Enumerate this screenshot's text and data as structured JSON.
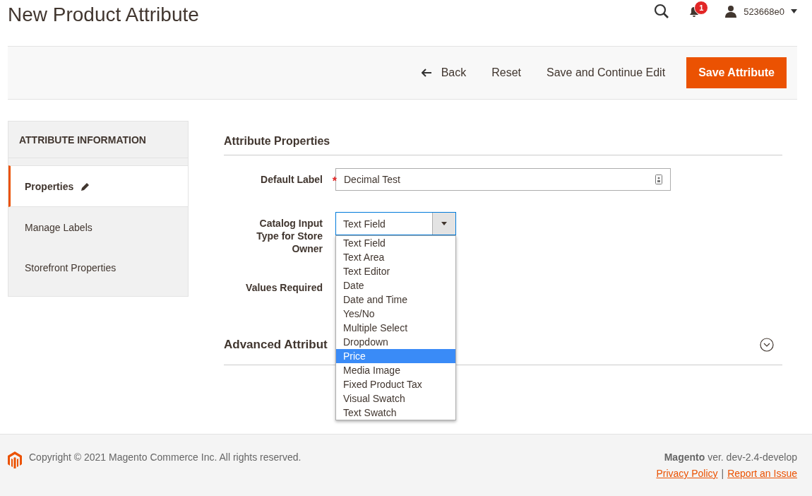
{
  "page_title": "New Product Attribute",
  "header": {
    "notification_count": "1",
    "user": "523668e0"
  },
  "actions": [
    {
      "label": "Back",
      "kind": "back"
    },
    {
      "label": "Reset",
      "kind": "plain"
    },
    {
      "label": "Save and Continue Edit",
      "kind": "plain"
    },
    {
      "label": "Save Attribute",
      "kind": "primary"
    }
  ],
  "sidebar": {
    "title": "ATTRIBUTE INFORMATION",
    "items": [
      {
        "label": "Properties",
        "selected": true
      },
      {
        "label": "Manage Labels",
        "selected": false
      },
      {
        "label": "Storefront Properties",
        "selected": false
      }
    ]
  },
  "section_title": "Attribute Properties",
  "default_label": {
    "label": "Default Label",
    "required_mark": "*",
    "value": "Decimal Test"
  },
  "input_type": {
    "label": "Catalog Input Type for Store Owner",
    "value": "Text Field",
    "expanded": true,
    "options": [
      {
        "label": "Text Field",
        "highlighted": false
      },
      {
        "label": "Text Area",
        "highlighted": false
      },
      {
        "label": "Text Editor",
        "highlighted": false
      },
      {
        "label": "Date",
        "highlighted": false
      },
      {
        "label": "Date and Time",
        "highlighted": false
      },
      {
        "label": "Yes/No",
        "highlighted": false
      },
      {
        "label": "Multiple Select",
        "highlighted": false
      },
      {
        "label": "Dropdown",
        "highlighted": false
      },
      {
        "label": "Price",
        "highlighted": true
      },
      {
        "label": "Media Image",
        "highlighted": false
      },
      {
        "label": "Fixed Product Tax",
        "highlighted": false
      },
      {
        "label": "Visual Swatch",
        "highlighted": false
      },
      {
        "label": "Text Swatch",
        "highlighted": false
      }
    ]
  },
  "values_required": {
    "label": "Values Required"
  },
  "advanced_title": "Advanced Attribut",
  "footer": {
    "copyright": "Copyright © 2021 Magento Commerce Inc. All rights reserved.",
    "version": "**Magento** ver. dev-2.4-develop",
    "links": [
      "Privacy Policy",
      "Report an Issue"
    ],
    "separator": "|"
  }
}
